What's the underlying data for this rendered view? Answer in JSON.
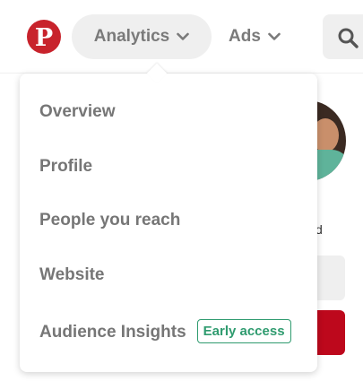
{
  "header": {
    "logo_text": "P",
    "nav": {
      "analytics_label": "Analytics",
      "ads_label": "Ads"
    }
  },
  "background": {
    "partial_text": "d"
  },
  "dropdown": {
    "items": [
      {
        "label": "Overview"
      },
      {
        "label": "Profile"
      },
      {
        "label": "People you reach"
      },
      {
        "label": "Website"
      },
      {
        "label": "Audience Insights",
        "badge": "Early access"
      }
    ]
  },
  "colors": {
    "brand_red": "#c8232c",
    "badge_green": "#2f9b6f",
    "menu_text": "#767676",
    "pill_bg": "#efefef"
  }
}
